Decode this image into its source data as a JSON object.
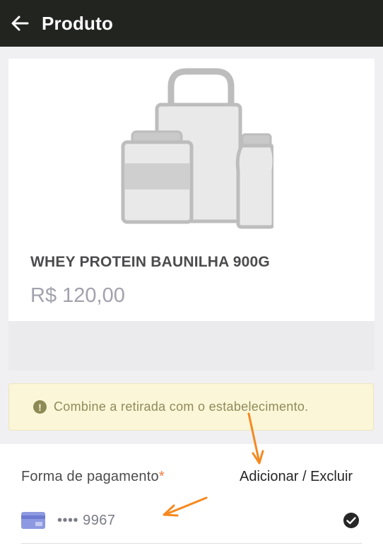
{
  "header": {
    "title": "Produto",
    "back_icon": "arrow-left-icon"
  },
  "product": {
    "name": "WHEY PROTEIN BAUNILHA 900G",
    "price": "R$ 120,00",
    "image_icon": "product-placeholder-icon"
  },
  "notice": {
    "icon": "exclamation-circle-icon",
    "text": "Combine a retirada com o estabelecimento."
  },
  "payment": {
    "label": "Forma de pagamento",
    "required_mark": "*",
    "add_label": "Adicionar",
    "separator": " / ",
    "remove_label": "Excluir",
    "selected_card": {
      "masked_number": "•••• 9967",
      "icon": "credit-card-icon",
      "status_icon": "check-circle-icon"
    }
  },
  "colors": {
    "header_bg": "#22241f",
    "notice_bg": "#fbf6d7",
    "required": "#f07b3c",
    "annotation_arrow": "#f5891f"
  }
}
